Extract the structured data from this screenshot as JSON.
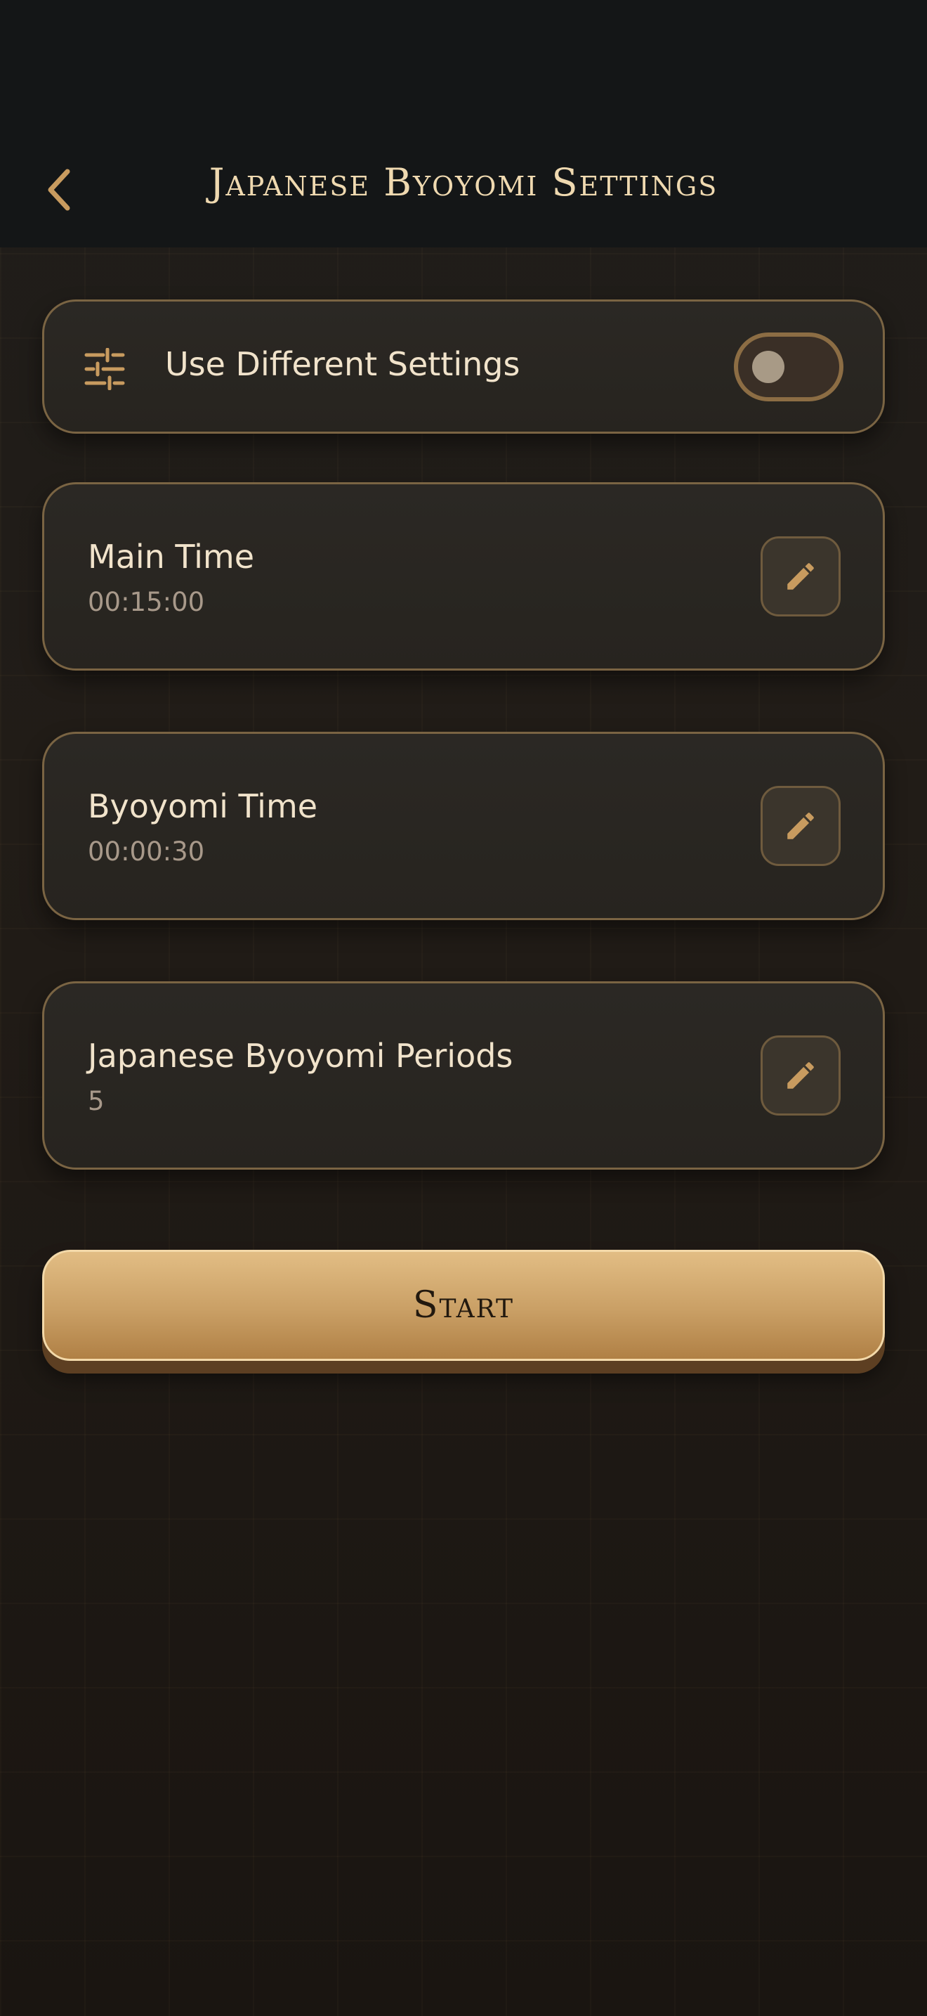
{
  "header": {
    "title": "Japanese Byoyomi Settings",
    "back_icon": "chevron-left-icon"
  },
  "toggle_card": {
    "icon": "sliders-icon",
    "label": "Use Different Settings",
    "enabled": false
  },
  "settings": [
    {
      "label": "Main Time",
      "value": "00:15:00",
      "action_icon": "pencil-icon"
    },
    {
      "label": "Byoyomi Time",
      "value": "00:00:30",
      "action_icon": "pencil-icon"
    },
    {
      "label": "Japanese Byoyomi Periods",
      "value": "5",
      "action_icon": "pencil-icon"
    }
  ],
  "start_button": {
    "label": "Start"
  },
  "colors": {
    "accent_gold": "#c89b5f",
    "text_primary": "#f1e3cb",
    "text_secondary": "#a8998a",
    "card_border": "#7a6443",
    "header_bg": "#141617"
  }
}
